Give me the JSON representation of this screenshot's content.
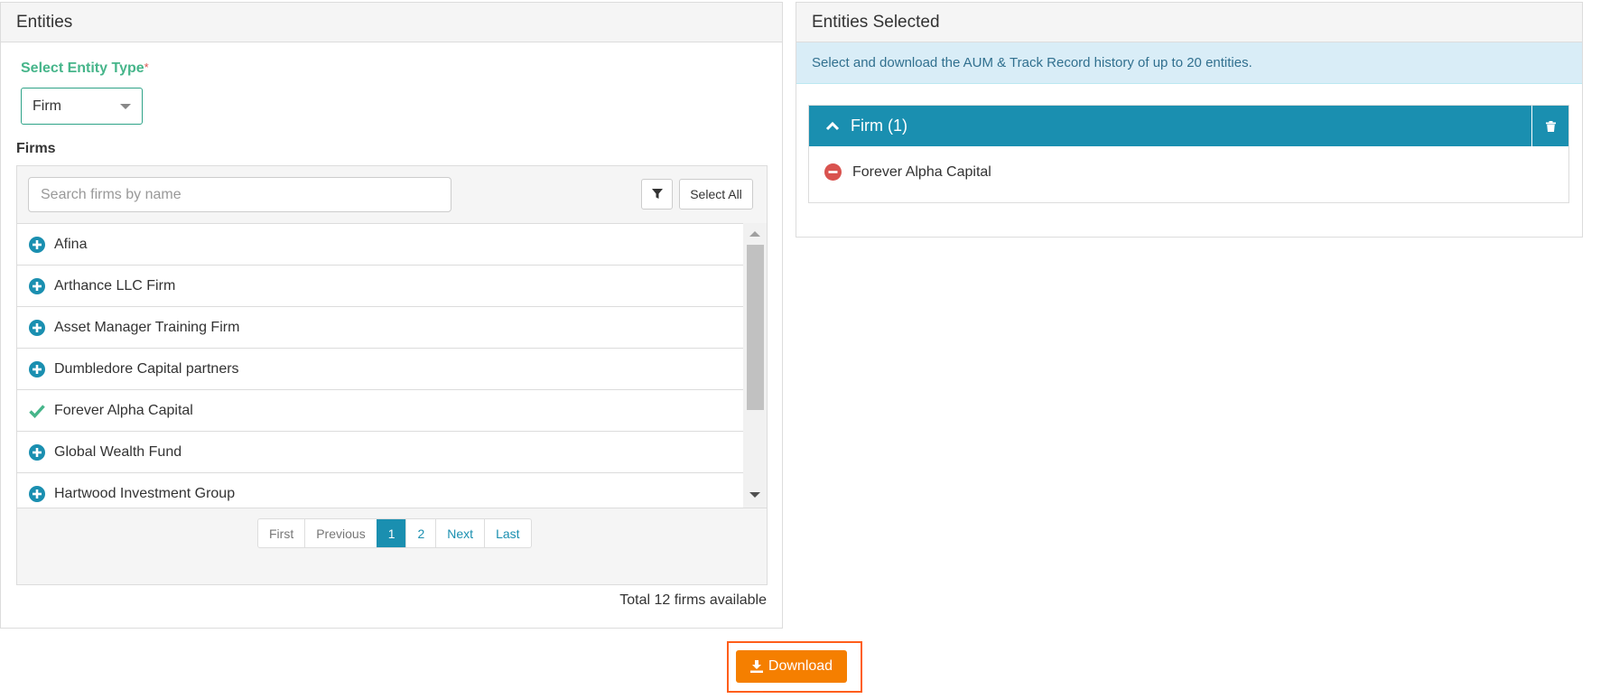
{
  "left_panel": {
    "title": "Entities",
    "entity_type_label": "Select Entity Type",
    "required_marker": "*",
    "entity_type_value": "Firm",
    "firms_label": "Firms",
    "search_placeholder": "Search firms by name",
    "select_all_label": "Select All",
    "firms": [
      {
        "name": "Afina",
        "state": "add"
      },
      {
        "name": "Arthance LLC Firm",
        "state": "add"
      },
      {
        "name": "Asset Manager Training Firm",
        "state": "add"
      },
      {
        "name": "Dumbledore Capital partners",
        "state": "add"
      },
      {
        "name": "Forever Alpha Capital",
        "state": "selected"
      },
      {
        "name": "Global Wealth Fund",
        "state": "add"
      },
      {
        "name": "Hartwood Investment Group",
        "state": "add"
      }
    ],
    "pagination": {
      "first": "First",
      "previous": "Previous",
      "page1": "1",
      "page2": "2",
      "next": "Next",
      "last": "Last"
    },
    "total_text": "Total 12 firms available"
  },
  "right_panel": {
    "title": "Entities Selected",
    "info_text": "Select and download the AUM & Track Record history of up to 20 entities.",
    "group_title": "Firm (1)",
    "selected_items": [
      "Forever Alpha Capital"
    ]
  },
  "download_label": "Download",
  "colors": {
    "accent": "#1a8fb0",
    "success": "#46b58a",
    "danger": "#d9534f",
    "download": "#f57f00",
    "highlight": "#ff5e1a"
  }
}
